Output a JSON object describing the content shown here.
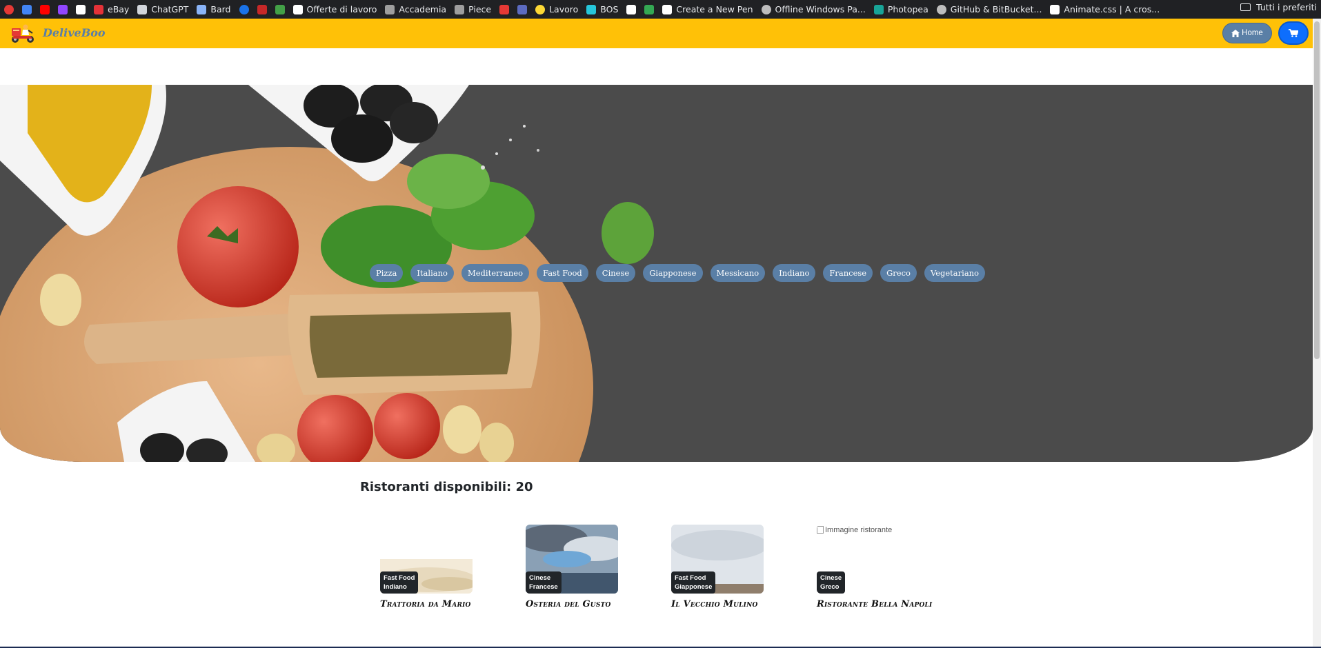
{
  "bookmarks": [
    {
      "label": "",
      "icon": "red-circle-icon",
      "color": "#e53935"
    },
    {
      "label": "",
      "icon": "google-translate-icon",
      "color": "#4285f4"
    },
    {
      "label": "",
      "icon": "youtube-icon",
      "color": "#ff0000"
    },
    {
      "label": "",
      "icon": "twitch-icon",
      "color": "#9146ff"
    },
    {
      "label": "",
      "icon": "amazon-icon",
      "color": "#ffffff"
    },
    {
      "label": "eBay",
      "icon": "ebay-icon",
      "color": "#e53238"
    },
    {
      "label": "ChatGPT",
      "icon": "chatgpt-icon",
      "color": "#d1d5db"
    },
    {
      "label": "Bard",
      "icon": "bard-sparkle-icon",
      "color": "#8ab4f8"
    },
    {
      "label": "",
      "icon": "play-circle-icon",
      "color": "#1a73e8"
    },
    {
      "label": "",
      "icon": "red-logo-icon",
      "color": "#c62828"
    },
    {
      "label": "",
      "icon": "green-leaf-icon",
      "color": "#43a047"
    },
    {
      "label": "Offerte di lavoro",
      "icon": "search-q-icon",
      "color": "#ffffff"
    },
    {
      "label": "Accademia",
      "icon": "ai-icon",
      "color": "#9e9e9e"
    },
    {
      "label": "Piece",
      "icon": "ai-icon",
      "color": "#9e9e9e"
    },
    {
      "label": "",
      "icon": "stripes-icon",
      "color": "#e53935"
    },
    {
      "label": "",
      "icon": "r-logo-icon",
      "color": "#5c6bc0"
    },
    {
      "label": "Lavoro",
      "icon": "yellow-circle-icon",
      "color": "#fdd835"
    },
    {
      "label": "BOS",
      "icon": "diamond-icon",
      "color": "#26c6da"
    },
    {
      "label": "",
      "icon": "github-icon",
      "color": "#ffffff"
    },
    {
      "label": "",
      "icon": "google-drive-icon",
      "color": "#34a853"
    },
    {
      "label": "Create a New Pen",
      "icon": "codepen-icon",
      "color": "#ffffff"
    },
    {
      "label": "Offline Windows Pa...",
      "icon": "globe-icon",
      "color": "#bdbdbd"
    },
    {
      "label": "Photopea",
      "icon": "photopea-icon",
      "color": "#18a497"
    },
    {
      "label": "GitHub & BitBucket...",
      "icon": "globe-icon",
      "color": "#bdbdbd"
    },
    {
      "label": "Animate.css | A cros...",
      "icon": "amazon-icon",
      "color": "#ffffff"
    }
  ],
  "bookmarks_folder": "Tutti i preferiti",
  "navbar": {
    "brand": "DeliveBoo",
    "home_label": "Home",
    "accent": "#ffc107",
    "brand_color": "#5a7fa6",
    "cart_color": "#0d6efd"
  },
  "categories": [
    "Pizza",
    "Italiano",
    "Mediterraneo",
    "Fast Food",
    "Cinese",
    "Giapponese",
    "Messicano",
    "Indiano",
    "Francese",
    "Greco",
    "Vegetariano"
  ],
  "restaurants_heading": "Ristoranti disponibili: 20",
  "restaurants": [
    {
      "name": "Trattoria da Mario",
      "tags": [
        "Fast Food",
        "Indiano"
      ],
      "image": "clouds-above-sky"
    },
    {
      "name": "Osteria del Gusto",
      "tags": [
        "Cinese",
        "Francese"
      ],
      "image": "cloudy-sky-mountains"
    },
    {
      "name": "Il Vecchio Mulino",
      "tags": [
        "Fast Food",
        "Giapponese"
      ],
      "image": "overcast-sky-field"
    },
    {
      "name": "Ristorante Bella Napoli",
      "tags": [
        "Cinese",
        "Greco"
      ],
      "image_alt": "Immagine ristorante"
    }
  ]
}
